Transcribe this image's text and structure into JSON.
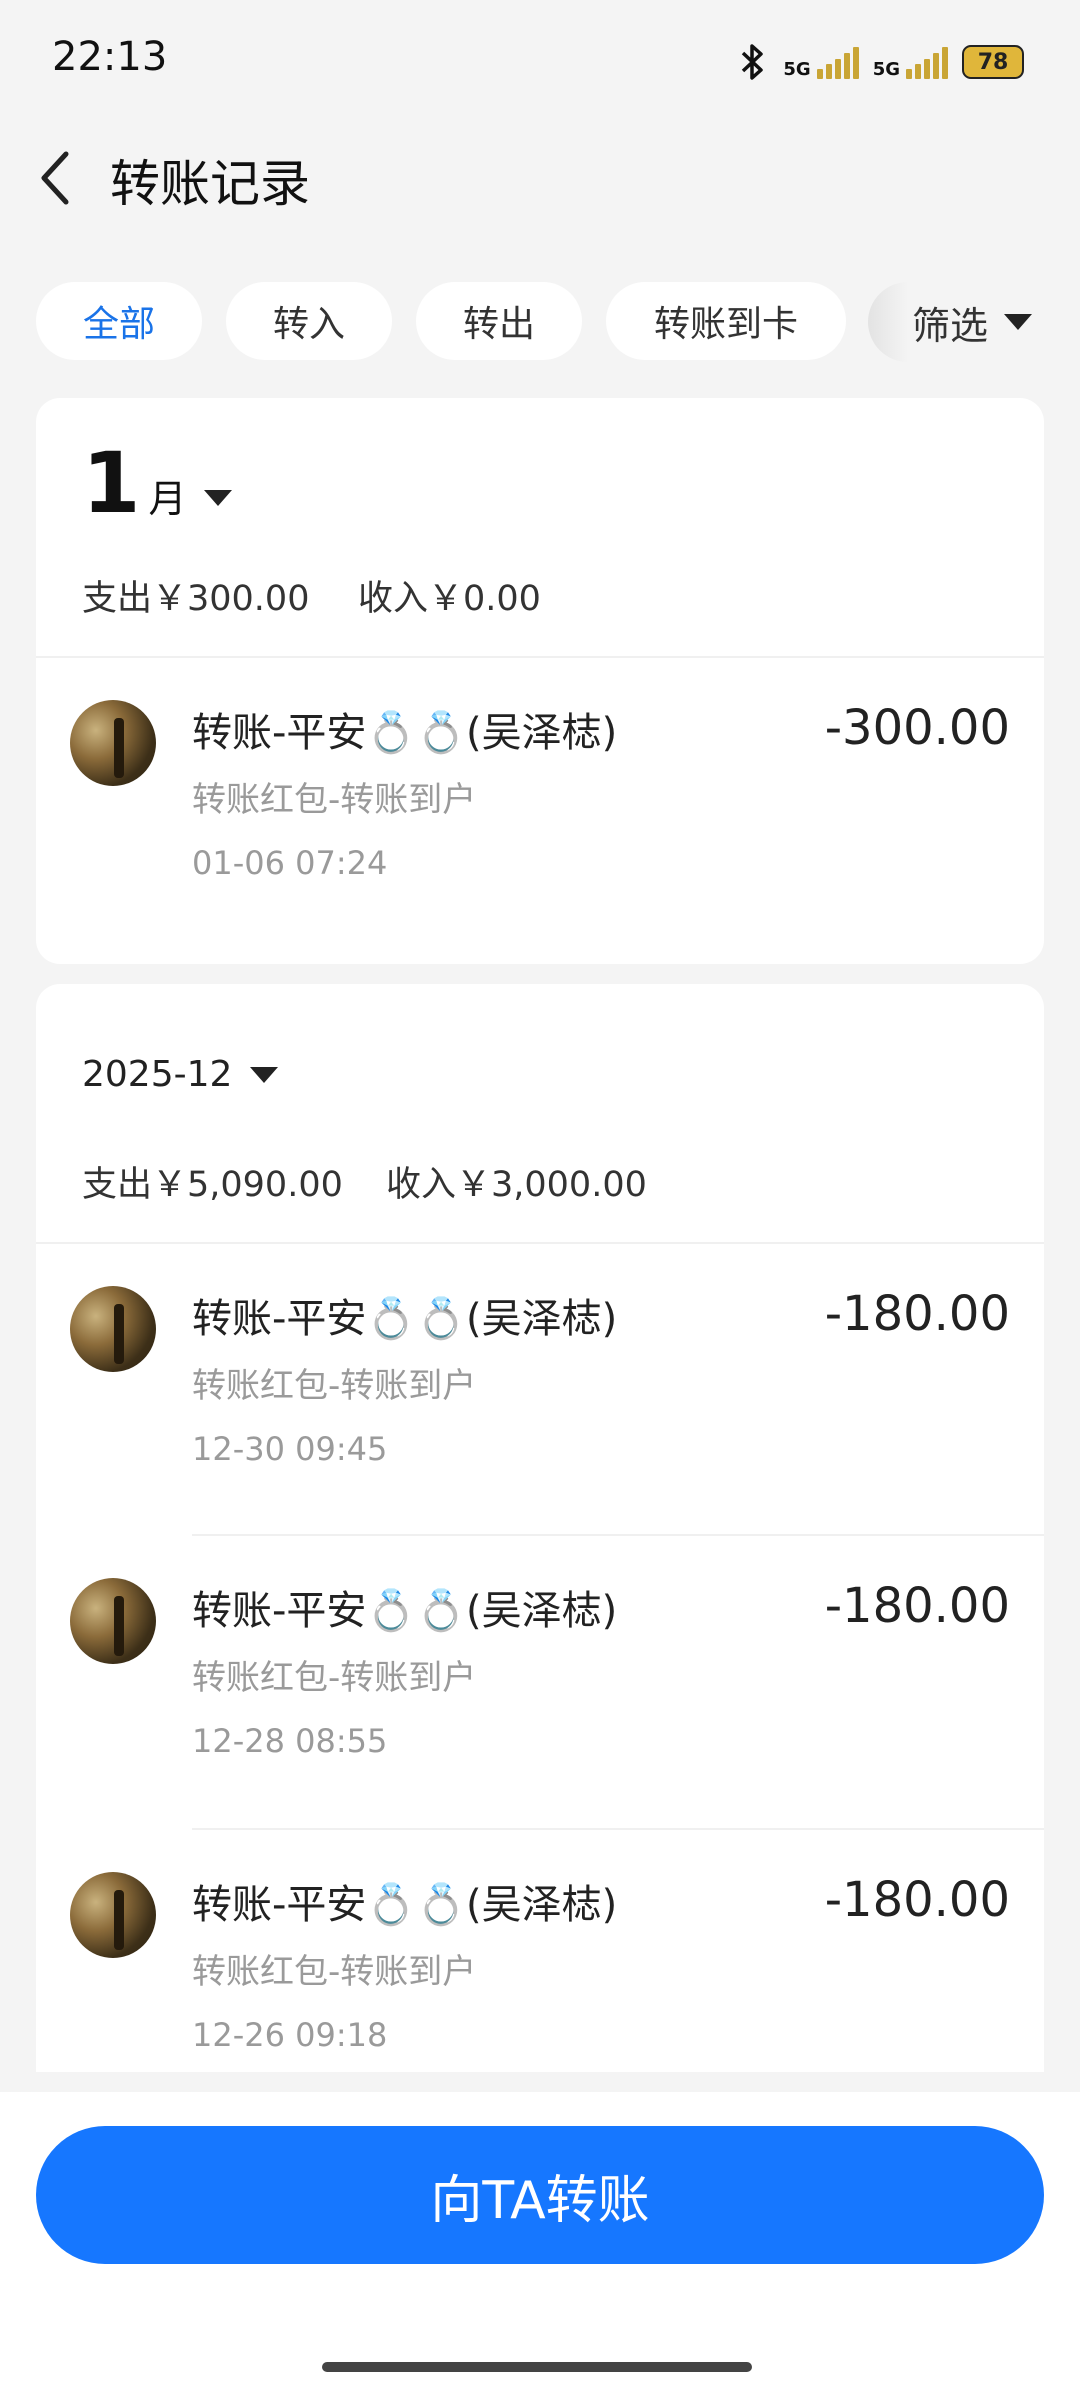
{
  "status_bar": {
    "time": "22:13",
    "network_1": "5G",
    "network_2": "5G",
    "battery": "78",
    "battery_color": "#e0b63a"
  },
  "header": {
    "title": "转账记录",
    "back_icon": "chevron-left-icon"
  },
  "tabs": [
    {
      "label": "全部",
      "active": true
    },
    {
      "label": "转入",
      "active": false
    },
    {
      "label": "转出",
      "active": false
    },
    {
      "label": "转账到卡",
      "active": false
    }
  ],
  "filter": {
    "label": "筛选"
  },
  "accent_color": "#1677ff",
  "groups": [
    {
      "month_number": "1",
      "month_suffix": "月",
      "expense": "支出￥300.00",
      "income": "收入￥0.00",
      "records": [
        {
          "title": "转账-平安💍💍(吴泽梽)",
          "subtitle": "转账红包-转账到户",
          "time": "01-06 07:24",
          "amount": "-300.00"
        }
      ]
    },
    {
      "month_label": "2025-12",
      "expense": "支出￥5,090.00",
      "income": "收入￥3,000.00",
      "records": [
        {
          "title": "转账-平安💍💍(吴泽梽)",
          "subtitle": "转账红包-转账到户",
          "time": "12-30 09:45",
          "amount": "-180.00"
        },
        {
          "title": "转账-平安💍💍(吴泽梽)",
          "subtitle": "转账红包-转账到户",
          "time": "12-28 08:55",
          "amount": "-180.00"
        },
        {
          "title": "转账-平安💍💍(吴泽梽)",
          "subtitle": "转账红包-转账到户",
          "time": "12-26 09:18",
          "amount": "-180.00"
        }
      ]
    }
  ],
  "cta": {
    "label": "向TA转账"
  }
}
